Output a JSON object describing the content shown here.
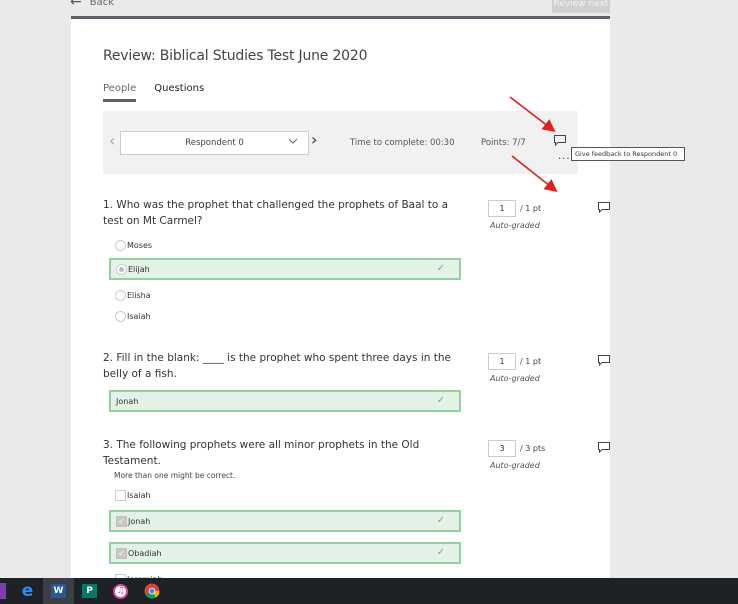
{
  "topbar": {
    "back_label": "Back",
    "review_next_label": "Review next"
  },
  "page": {
    "title": "Review: Biblical Studies Test June 2020",
    "tabs": [
      {
        "label": "People",
        "active": true
      },
      {
        "label": "Questions",
        "active": false
      }
    ]
  },
  "respondent_bar": {
    "selected_respondent": "Respondent 0",
    "time_to_complete": "Time to complete: 00:30",
    "points": "Points: 7/7",
    "more_label": "...",
    "tooltip": "Give feedback to Respondent 0"
  },
  "questions": [
    {
      "number": "1.",
      "text": "1. Who was the prophet that challenged the prophets of Baal to a test on Mt Carmel?",
      "score": "1",
      "max": "/ 1 pt",
      "grading": "Auto-graded",
      "type": "radio",
      "options": [
        {
          "label": "Moses",
          "selected": false,
          "correct": false
        },
        {
          "label": "Elijah",
          "selected": true,
          "correct": true
        },
        {
          "label": "Elisha",
          "selected": false,
          "correct": false
        },
        {
          "label": "Isaiah",
          "selected": false,
          "correct": false
        }
      ]
    },
    {
      "number": "2.",
      "text": "2. Fill in the blank: ____ is the prophet who spent three days in the belly of a fish.",
      "score": "1",
      "max": "/ 1 pt",
      "grading": "Auto-graded",
      "type": "text",
      "answer": "Jonah"
    },
    {
      "number": "3.",
      "text": "3. The following prophets were all minor prophets in the Old Testament.",
      "subtext": "More than one might be correct.",
      "score": "3",
      "max": "/ 3 pts",
      "grading": "Auto-graded",
      "type": "checkbox",
      "options": [
        {
          "label": "Isaiah",
          "selected": false,
          "correct": false
        },
        {
          "label": "Jonah",
          "selected": true,
          "correct": true
        },
        {
          "label": "Obadiah",
          "selected": true,
          "correct": true
        },
        {
          "label": "Jeremiah",
          "selected": false,
          "correct": false
        }
      ]
    }
  ],
  "icons": {
    "check": "✓",
    "chevron_left": "‹",
    "chevron_right": "›",
    "chevron_down": "⌄",
    "back_arrow": "←"
  },
  "colors": {
    "accent_dark": "#5b6166",
    "correct_bg": "#e4f1e6",
    "correct_border": "#94cfa1",
    "annotation_arrow": "#e0201b"
  },
  "taskbar": {
    "apps": [
      "Edge",
      "Word",
      "Publisher",
      "iTunes",
      "Chrome"
    ]
  }
}
